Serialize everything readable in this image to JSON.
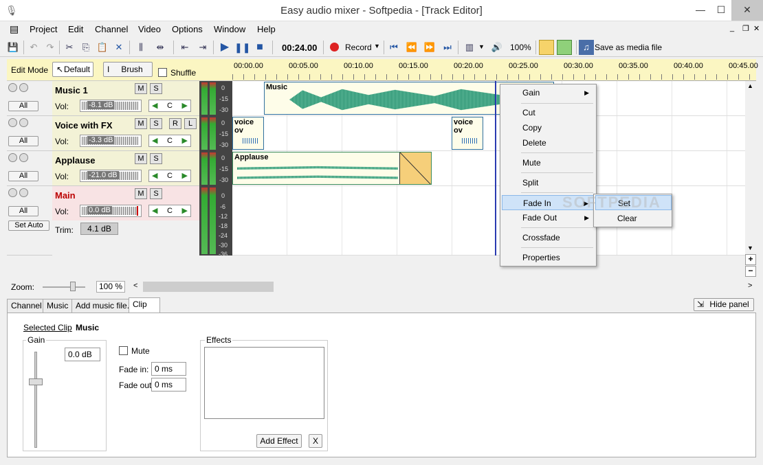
{
  "window": {
    "title": "Easy audio mixer - Softpedia - [Track Editor]"
  },
  "menu": [
    "Project",
    "Edit",
    "Channel",
    "Video",
    "Options",
    "Window",
    "Help"
  ],
  "toolbar": {
    "time": "00:24.00",
    "record_label": "Record",
    "zoom": "100%",
    "save_label": "Save as media file"
  },
  "modebar": {
    "edit_mode": "Edit Mode",
    "default_label": "Default",
    "brush_label": "Brush",
    "shuffle_label": "Shuffle"
  },
  "ruler": [
    "00:00.00",
    "00:05.00",
    "00:10.00",
    "00:15.00",
    "00:20.00",
    "00:25.00",
    "00:30.00",
    "00:35.00",
    "00:40.00",
    "00:45.00"
  ],
  "tracks": [
    {
      "name": "Music 1",
      "vol_label": "Vol:",
      "vol": "-8.1 dB",
      "pan": "C",
      "all": "All",
      "m": "M",
      "s": "S"
    },
    {
      "name": "Voice with FX",
      "vol_label": "Vol:",
      "vol": "-3.3 dB",
      "pan": "C",
      "all": "All",
      "m": "M",
      "s": "S",
      "r": "R",
      "l": "L"
    },
    {
      "name": "Applause",
      "vol_label": "Vol:",
      "vol": "-21.0 dB",
      "pan": "C",
      "all": "All",
      "m": "M",
      "s": "S"
    },
    {
      "name": "Main",
      "vol_label": "Vol:",
      "vol": "0.0 dB",
      "pan": "C",
      "all": "All",
      "m": "M",
      "s": "S",
      "set_auto": "Set Auto",
      "trim_label": "Trim:",
      "trim": "4.1 dB"
    }
  ],
  "meters": {
    "short": [
      "0",
      "-15",
      "-30"
    ],
    "main": [
      "0",
      "-6",
      "-12",
      "-18",
      "-24",
      "-30",
      "-36"
    ]
  },
  "clips": {
    "music": "Music",
    "voice1": "voice ov",
    "voice2": "voice ov",
    "applause": "Applause"
  },
  "context_menu": {
    "gain": "Gain",
    "cut": "Cut",
    "copy": "Copy",
    "delete": "Delete",
    "mute": "Mute",
    "split": "Split",
    "fade_in": "Fade In",
    "fade_out": "Fade Out",
    "crossfade": "Crossfade",
    "properties": "Properties"
  },
  "submenu": {
    "set": "Set",
    "clear": "Clear"
  },
  "watermark": "SOFTPEDIA",
  "zoom": {
    "label": "Zoom:",
    "value": "100 %"
  },
  "tabs": [
    "Channel",
    "Music",
    "Add music file...",
    "Clip"
  ],
  "hide_panel": "Hide panel",
  "clip_panel": {
    "selected_label": "Selected Clip",
    "selected_value": "Music",
    "gain_label": "Gain",
    "gain_value": "0.0 dB",
    "mute_label": "Mute",
    "fade_in_label": "Fade in:",
    "fade_in": "0 ms",
    "fade_out_label": "Fade out:",
    "fade_out": "0 ms",
    "effects_label": "Effects",
    "add_effect": "Add Effect",
    "remove": "X"
  }
}
